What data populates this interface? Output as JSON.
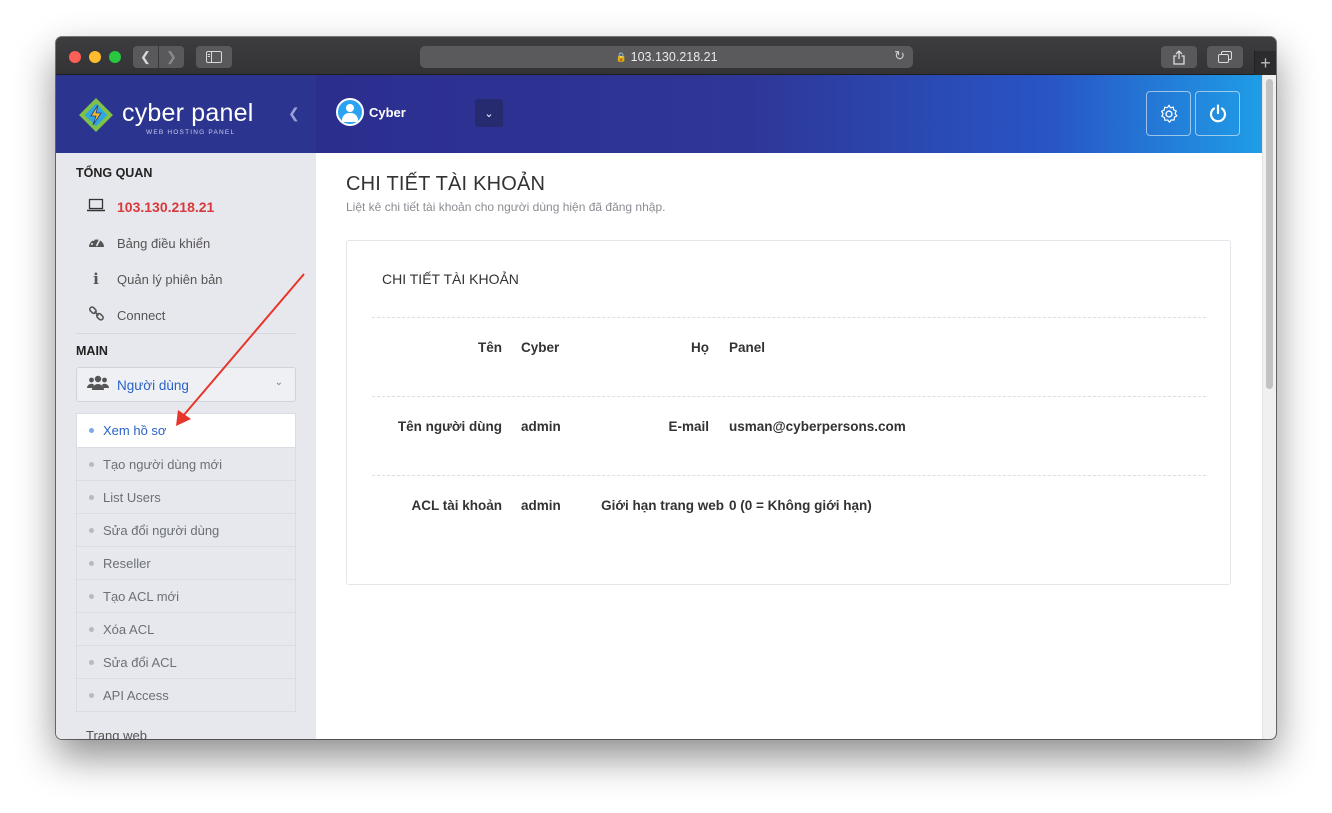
{
  "browser": {
    "url": "103.130.218.21",
    "back_icon": "chevron-left-icon",
    "forward_icon": "chevron-right-icon",
    "new_tab": "+"
  },
  "brand": {
    "name": "cyber panel",
    "subtitle": "WEB HOSTING PANEL"
  },
  "topbar": {
    "user_name": "Cyber",
    "colors": {
      "start": "#2c2e8e",
      "end": "#1f9de6"
    }
  },
  "sidebar": {
    "section_overview": "TỔNG QUAN",
    "overview_items": [
      {
        "label": "103.130.218.21",
        "icon": "laptop-icon"
      },
      {
        "label": "Bảng điều khiển",
        "icon": "dashboard-icon"
      },
      {
        "label": "Quản lý phiên bản",
        "icon": "info-icon"
      },
      {
        "label": "Connect",
        "icon": "link-icon"
      }
    ],
    "section_main": "MAIN",
    "users_group": {
      "label": "Người dùng",
      "icon": "users-icon"
    },
    "user_subitems": [
      {
        "label": "Xem hồ sơ",
        "active": true
      },
      {
        "label": "Tạo người dùng mới"
      },
      {
        "label": "List Users"
      },
      {
        "label": "Sửa đổi người dùng"
      },
      {
        "label": "Reseller"
      },
      {
        "label": "Tạo ACL mới"
      },
      {
        "label": "Xóa ACL"
      },
      {
        "label": "Sửa đổi ACL"
      },
      {
        "label": "API Access"
      }
    ],
    "next_group_partial": "Trang web"
  },
  "main": {
    "title": "CHI TIẾT TÀI KHOẢN",
    "subtitle": "Liệt kê chi tiết tài khoản cho người dùng hiện đã đăng nhập.",
    "card_title": "CHI TIẾT TÀI KHOẢN",
    "rows": [
      {
        "label1": "Tên",
        "value1": "Cyber",
        "label2": "Họ",
        "value2": "Panel"
      },
      {
        "label1": "Tên người dùng",
        "value1": "admin",
        "label2": "E-mail",
        "value2": "usman@cyberpersons.com"
      },
      {
        "label1": "ACL tài khoản",
        "value1": "admin",
        "label2": "Giới hạn trang web",
        "value2": "0 (0 = Không giới hạn)"
      }
    ]
  },
  "annotation": {
    "color": "#e8352b"
  }
}
